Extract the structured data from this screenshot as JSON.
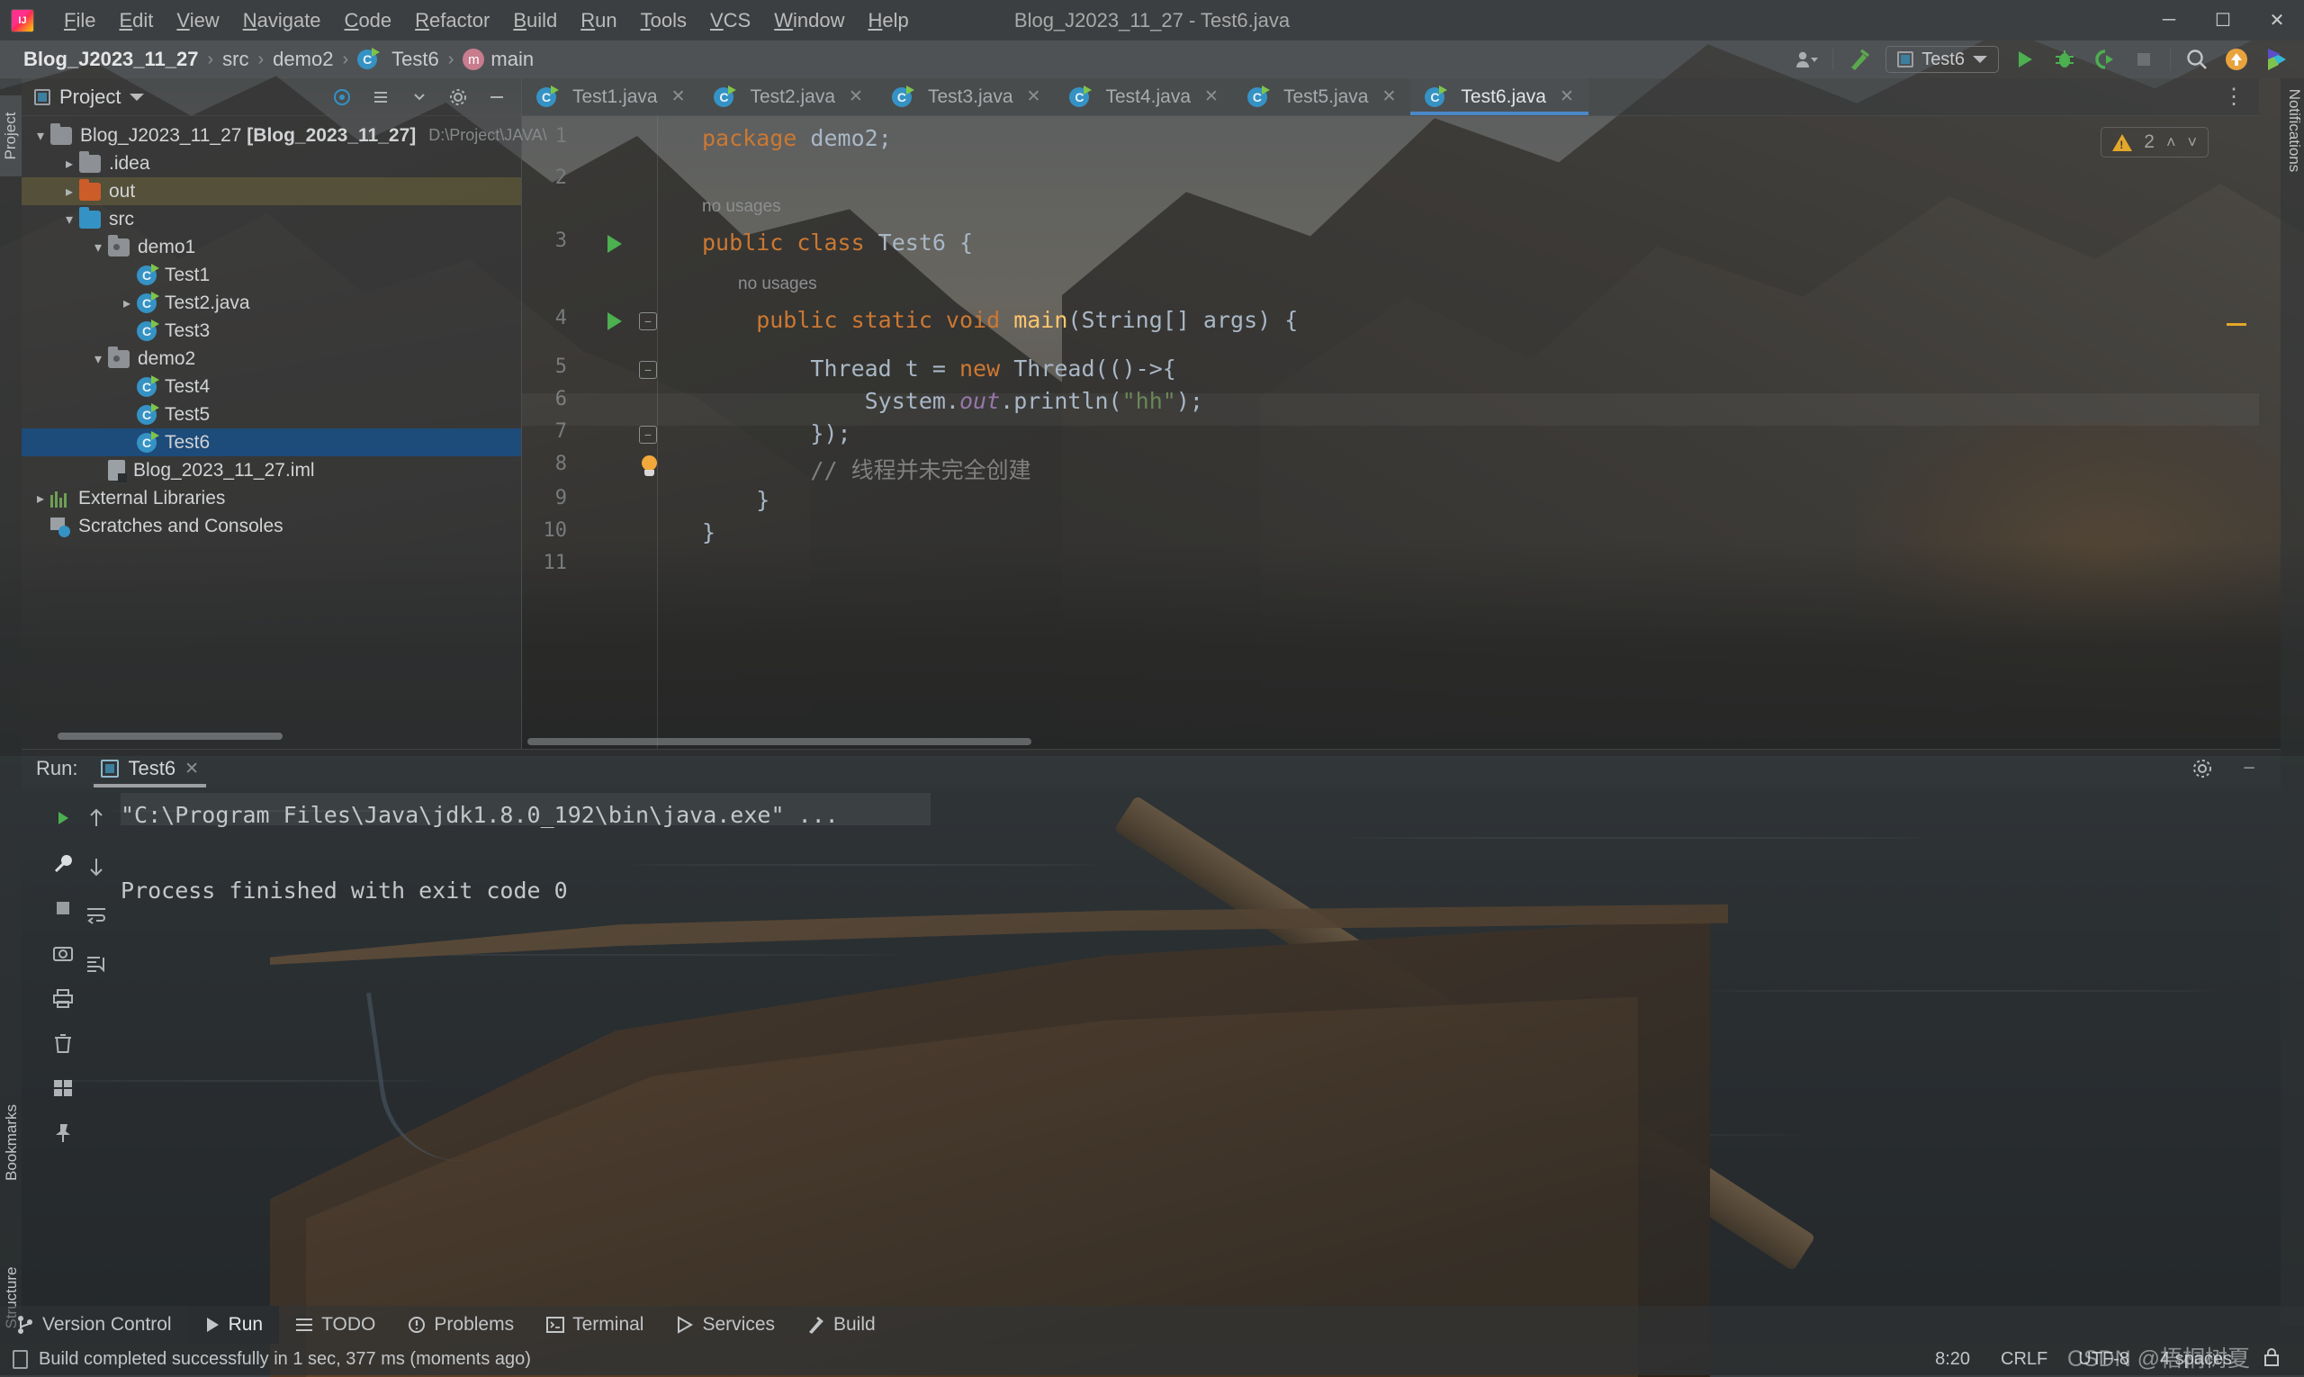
{
  "titlebar": {
    "logo_icon": "intellij-logo-icon",
    "title": "Blog_J2023_11_27 - Test6.java",
    "menus": [
      "File",
      "Edit",
      "View",
      "Navigate",
      "Code",
      "Refactor",
      "Build",
      "Run",
      "Tools",
      "VCS",
      "Window",
      "Help"
    ],
    "minimize": "─",
    "maximize": "☐",
    "close": "✕"
  },
  "navbar": {
    "crumbs": [
      {
        "label": "Blog_J2023_11_27",
        "icon": "none",
        "bold": true
      },
      {
        "label": "src",
        "icon": "none",
        "bold": false
      },
      {
        "label": "demo2",
        "icon": "none",
        "bold": false
      },
      {
        "label": "Test6",
        "icon": "java-class-icon",
        "bold": false
      },
      {
        "label": "main",
        "icon": "method-icon",
        "bold": false
      }
    ],
    "separator": "›",
    "right": {
      "account_icon": "user-account-icon",
      "build_icon": "build-hammer-icon",
      "run_config": "Test6",
      "run_icon": "run-icon",
      "debug_icon": "debug-bug-icon",
      "coverage_icon": "run-coverage-icon",
      "stop_icon": "stop-icon",
      "search_icon": "search-icon",
      "update_icon": "update-arrow-icon",
      "ai_icon": "ai-assistant-icon"
    }
  },
  "left_strip": {
    "project": "Project",
    "bookmarks": "Bookmarks",
    "structure": "Structure"
  },
  "right_strip": {
    "notifications": "Notifications"
  },
  "project_panel": {
    "title": "Project",
    "dropdown_icon": "chevron-down-icon",
    "header_icons": [
      "target-icon",
      "collapse-all-icon",
      "expand-icon",
      "settings-gear-icon",
      "hide-icon"
    ],
    "tree": [
      {
        "label": "Blog_J2023_11_27 [Blog_2023_11_27]",
        "suffix": "D:\\Project\\JAVA\\",
        "icon": "module-folder-icon",
        "depth": 0,
        "arrow": "open",
        "state": "normal"
      },
      {
        "label": ".idea",
        "icon": "folder-icon",
        "depth": 1,
        "arrow": "closed",
        "state": "normal"
      },
      {
        "label": "out",
        "icon": "folder-orange-icon",
        "depth": 1,
        "arrow": "closed",
        "state": "highlighted"
      },
      {
        "label": "src",
        "icon": "folder-blue-icon",
        "depth": 1,
        "arrow": "open",
        "state": "normal"
      },
      {
        "label": "demo1",
        "icon": "package-icon",
        "depth": 2,
        "arrow": "open",
        "state": "normal"
      },
      {
        "label": "Test1",
        "icon": "java-class-icon",
        "depth": 3,
        "arrow": "none",
        "state": "normal"
      },
      {
        "label": "Test2.java",
        "icon": "java-class-icon",
        "depth": 3,
        "arrow": "closed",
        "state": "normal"
      },
      {
        "label": "Test3",
        "icon": "java-class-icon",
        "depth": 3,
        "arrow": "none",
        "state": "normal"
      },
      {
        "label": "demo2",
        "icon": "package-icon",
        "depth": 2,
        "arrow": "open",
        "state": "normal"
      },
      {
        "label": "Test4",
        "icon": "java-class-icon",
        "depth": 3,
        "arrow": "none",
        "state": "normal"
      },
      {
        "label": "Test5",
        "icon": "java-class-icon",
        "depth": 3,
        "arrow": "none",
        "state": "normal"
      },
      {
        "label": "Test6",
        "icon": "java-class-icon",
        "depth": 3,
        "arrow": "none",
        "state": "selected"
      },
      {
        "label": "Blog_2023_11_27.iml",
        "icon": "iml-file-icon",
        "depth": 2,
        "arrow": "none",
        "state": "normal"
      },
      {
        "label": "External Libraries",
        "icon": "libraries-icon",
        "depth": 0,
        "arrow": "closed",
        "state": "normal"
      },
      {
        "label": "Scratches and Consoles",
        "icon": "scratches-icon",
        "depth": 0,
        "arrow": "none",
        "state": "normal"
      }
    ]
  },
  "editor": {
    "tabs": [
      {
        "label": "Test1.java",
        "active": false
      },
      {
        "label": "Test2.java",
        "active": false
      },
      {
        "label": "Test3.java",
        "active": false
      },
      {
        "label": "Test4.java",
        "active": false
      },
      {
        "label": "Test5.java",
        "active": false
      },
      {
        "label": "Test6.java",
        "active": true
      }
    ],
    "tab_close_icon": "✕",
    "tab_overflow_icon": "⋮",
    "line_numbers": [
      "1",
      "2",
      "3",
      "4",
      "5",
      "6",
      "7",
      "8",
      "9",
      "10",
      "11"
    ],
    "inline_hints": [
      {
        "text": "no usages",
        "line": 3
      },
      {
        "text": "no usages",
        "line": 4
      }
    ],
    "code_lines": [
      {
        "line": 1,
        "tokens": [
          {
            "t": "package ",
            "c": "kw"
          },
          {
            "t": "demo2",
            "c": "cls"
          },
          {
            "t": ";",
            "c": "pl"
          }
        ]
      },
      {
        "line": 2,
        "tokens": []
      },
      {
        "line": 3,
        "tokens": [
          {
            "t": "public class ",
            "c": "kw"
          },
          {
            "t": "Test6",
            "c": "cls"
          },
          {
            "t": " {",
            "c": "pl"
          }
        ]
      },
      {
        "line": 4,
        "tokens": [
          {
            "t": "    public static void ",
            "c": "kw"
          },
          {
            "t": "main",
            "c": "fn"
          },
          {
            "t": "(String[] args) {",
            "c": "pl"
          }
        ]
      },
      {
        "line": 5,
        "tokens": [
          {
            "t": "        Thread ",
            "c": "cls"
          },
          {
            "t": "t",
            "c": "pl"
          },
          {
            "t": " = ",
            "c": "pl"
          },
          {
            "t": "new ",
            "c": "kw"
          },
          {
            "t": "Thread(()->{",
            "c": "pl"
          }
        ]
      },
      {
        "line": 6,
        "tokens": [
          {
            "t": "            System.",
            "c": "pl"
          },
          {
            "t": "out",
            "c": "sfield"
          },
          {
            "t": ".println(",
            "c": "pl"
          },
          {
            "t": "\"hh\"",
            "c": "str"
          },
          {
            "t": ");",
            "c": "pl"
          }
        ]
      },
      {
        "line": 7,
        "tokens": [
          {
            "t": "        });",
            "c": "pl"
          }
        ]
      },
      {
        "line": 8,
        "tokens": [
          {
            "t": "        // 线程并未完全创建",
            "c": "com"
          }
        ]
      },
      {
        "line": 9,
        "tokens": [
          {
            "t": "    }",
            "c": "pl"
          }
        ]
      },
      {
        "line": 10,
        "tokens": [
          {
            "t": "}",
            "c": "pl"
          }
        ]
      },
      {
        "line": 11,
        "tokens": []
      }
    ],
    "inspection": {
      "warning_icon": "warning-triangle-icon",
      "count": "2",
      "prev_icon": "˄",
      "next_icon": "˅"
    }
  },
  "run_panel": {
    "label": "Run:",
    "tab": "Test6",
    "tab_close_icon": "✕",
    "settings_icon": "settings-gear-icon",
    "minimize_icon": "─",
    "toolbar_icons": [
      "rerun-icon",
      "wrench-icon",
      "stop-icon",
      "camera-icon",
      "print-icon",
      "trash-icon",
      "layout-icon",
      "pin-icon"
    ],
    "toolbar_icons2": [
      "scroll-up-icon",
      "scroll-down-icon",
      "soft-wrap-icon",
      "scroll-to-end-icon"
    ],
    "console_lines": [
      "\"C:\\Program Files\\Java\\jdk1.8.0_192\\bin\\java.exe\" ...",
      "",
      "Process finished with exit code 0"
    ]
  },
  "bottom_bar": {
    "items": [
      {
        "label": "Version Control",
        "icon": "git-branch-icon",
        "active": false
      },
      {
        "label": "Run",
        "icon": "run-icon",
        "active": true
      },
      {
        "label": "TODO",
        "icon": "todo-list-icon",
        "active": false
      },
      {
        "label": "Problems",
        "icon": "problems-icon",
        "active": false
      },
      {
        "label": "Terminal",
        "icon": "terminal-icon",
        "active": false
      },
      {
        "label": "Services",
        "icon": "services-icon",
        "active": false
      },
      {
        "label": "Build",
        "icon": "build-hammer-icon",
        "active": false
      }
    ]
  },
  "status_bar": {
    "icon": "event-log-icon",
    "message": "Build completed successfully in 1 sec, 377 ms (moments ago)",
    "caret_position": "8:20",
    "line_separator": "CRLF",
    "encoding": "UTF-8",
    "indent": "4 spaces",
    "lock_icon": "lock-icon"
  },
  "watermark": "CSDN @梧桐树夏",
  "colors": {
    "accent_blue": "#4a88c7",
    "selection_blue": "#1d4b7a",
    "keyword_orange": "#cc7832",
    "string_green": "#6a8759",
    "method_yellow": "#ffc66d",
    "field_purple": "#9876aa",
    "comment_gray": "#808080",
    "warning_yellow": "#e3a72a",
    "run_green": "#4caf50",
    "chrome_bg": "#3c3f41"
  }
}
